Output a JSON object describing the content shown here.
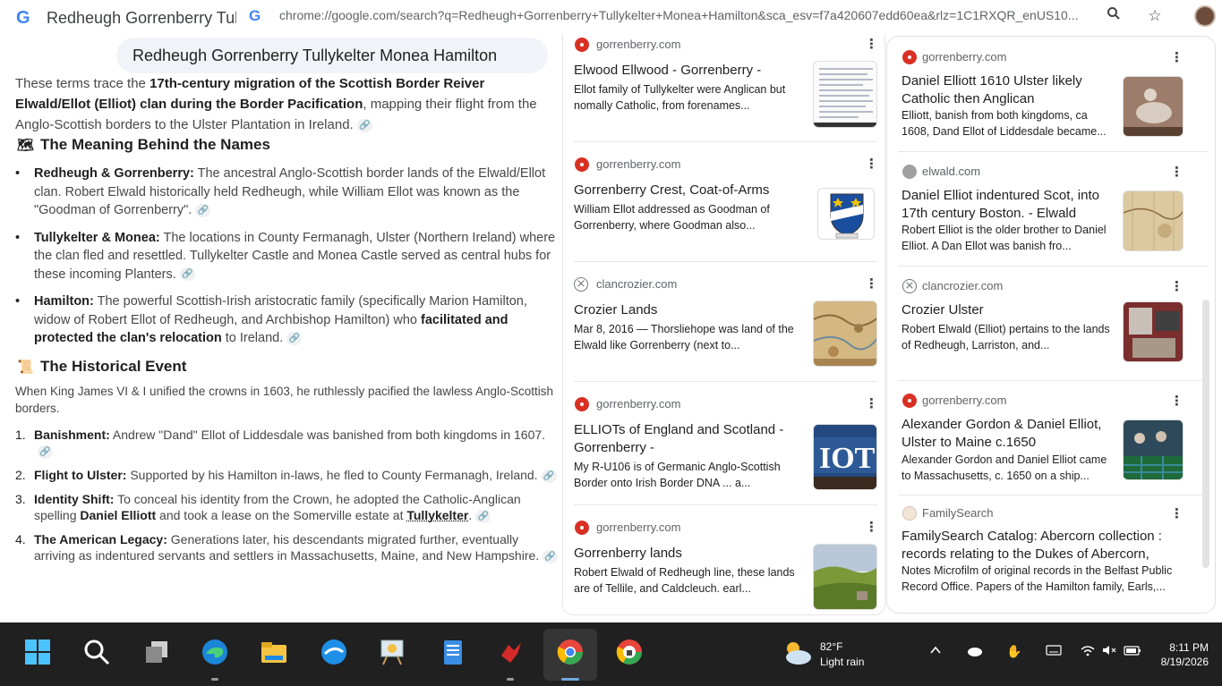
{
  "browser": {
    "tab_title": "Redheugh Gorrenberry Tully",
    "url": "chrome://google.com/search?q=Redheugh+Gorrenberry+Tullykelter+Monea+Hamilton&sca_esv=f7a420607edd60ea&rlz=1C1RXQR_enUS10..."
  },
  "answer": {
    "query": "Redheugh Gorrenberry Tullykelter Monea Hamilton",
    "intro_pre": "These terms trace the ",
    "intro_bold": "17th-century migration of the Scottish Border Reiver Elwald/Ellot (Elliot) clan during the Border Pacification",
    "intro_post": ", mapping their flight from the Anglo-Scottish borders to the Ulster Plantation in Ireland.",
    "section1_title": "The Meaning Behind the Names",
    "section1_emoji": "🗺",
    "names": [
      {
        "term": "Redheugh & Gorrenberry:",
        "text": " The ancestral Anglo-Scottish border lands of the Elwald/Ellot clan. Robert Elwald historically held Redheugh, while William Ellot was known as the \"Goodman of Gorrenberry\"."
      },
      {
        "term": "Tullykelter & Monea:",
        "text": " The locations in County Fermanagh, Ulster (Northern Ireland) where the clan fled and resettled. Tullykelter Castle and Monea Castle served as central hubs for these incoming Planters."
      },
      {
        "term": "Hamilton:",
        "text": " The powerful Scottish-Irish aristocratic family (specifically Marion Hamilton, widow of Robert Ellot of Redheugh, and Archbishop Hamilton) who ",
        "bold2": "facilitated and protected the clan's relocation",
        "tail": " to Ireland."
      }
    ],
    "section2_title": "The Historical Event",
    "section2_emoji": "📜",
    "section2_intro": "When King James VI & I unified the crowns in 1603, he ruthlessly pacified the lawless Anglo-Scottish borders.",
    "events": [
      {
        "n": "1.",
        "term": "Banishment:",
        "text": " Andrew \"Dand\" Ellot of Liddesdale was banished from both kingdoms in 1607."
      },
      {
        "n": "2.",
        "term": "Flight to Ulster:",
        "text": " Supported by his Hamilton in-laws, he fled to County Fermanagh, Ireland."
      },
      {
        "n": "3.",
        "term": "Identity Shift:",
        "text": " To conceal his identity from the Crown, he adopted the Catholic-Anglican spelling ",
        "bold2": "Daniel Elliott",
        "mid": " and took a lease on the Somerville estate at ",
        "bold3": "Tullykelter",
        "tail": "."
      },
      {
        "n": "4.",
        "term": "The American Legacy:",
        "text": " Generations later, his descendants migrated further, eventually arriving as indentured servants and settlers in Massachusetts, Maine, and New Hampshire."
      }
    ]
  },
  "sources_col1": [
    {
      "domain": "gorrenberry.com",
      "favicon": "gorrenberry-favicon",
      "title": "Elwood Ellwood - Gorrenberry -",
      "snippet": "Ellot family of Tullykelter were Anglican but nomally Catholic, from forenames..."
    },
    {
      "domain": "gorrenberry.com",
      "favicon": "gorrenberry-favicon",
      "title": "Gorrenberry Crest, Coat-of-Arms",
      "snippet": "William Ellot addressed as Goodman of Gorrenberry, where Goodman also..."
    },
    {
      "domain": "clancrozier.com",
      "favicon": "clancrozier-favicon",
      "title": "Crozier Lands",
      "snippet": "Mar 8, 2016 — Thorsliehope was land of the Elwald like Gorrenberry (next to..."
    },
    {
      "domain": "gorrenberry.com",
      "favicon": "gorrenberry-favicon",
      "title": "ELLIOTs of England and Scotland - Gorrenberry -",
      "snippet": "My R-U106 is of Germanic Anglo-Scottish Border onto Irish Border DNA ... a..."
    },
    {
      "domain": "gorrenberry.com",
      "favicon": "gorrenberry-favicon",
      "title": "Gorrenberry lands",
      "snippet": "Robert Elwald of Redheugh line, these lands are of Tellile, and Caldcleuch. earl..."
    }
  ],
  "sources_col2": [
    {
      "domain": "gorrenberry.com",
      "favicon": "gorrenberry-favicon",
      "title": "Daniel Elliott 1610 Ulster likely Catholic then Anglican",
      "snippet": "Elliott, banish from both kingdoms, ca 1608, Dand Ellot of Liddesdale became..."
    },
    {
      "domain": "elwald.com",
      "favicon": "elwald-favicon",
      "title": "Daniel Elliot indentured Scot, into 17th century Boston. - Elwald",
      "snippet": "Robert Elliot is the older brother to Daniel Elliot. A Dan Ellot was banish fro..."
    },
    {
      "domain": "clancrozier.com",
      "favicon": "clancrozier-favicon",
      "title": "Crozier Ulster",
      "snippet": "Robert Elwald (Elliot) pertains to the lands of Redheugh, Larriston, and..."
    },
    {
      "domain": "gorrenberry.com",
      "favicon": "gorrenberry-favicon",
      "title": "Alexander Gordon & Daniel Elliot, Ulster to Maine c.1650",
      "snippet": "Alexander Gordon and Daniel Elliot came to Massachusetts, c. 1650 on a ship..."
    },
    {
      "domain": "FamilySearch",
      "favicon": "familysearch-favicon",
      "title": "FamilySearch Catalog: Abercorn collection : records relating to the Dukes of Abercorn, c....",
      "snippet": "Notes Microfilm of original records in the Belfast Public Record Office. Papers of the Hamilton family, Earls,..."
    }
  ],
  "taskbar": {
    "weather_temp": "82°F",
    "weather_cond": "Light rain",
    "time": "8:11 PM",
    "date": "8/19/2026"
  },
  "colors": {
    "google_blue": "#4285f4",
    "taskbar_bg": "#202020",
    "query_bubble": "#f0f4f9",
    "favicon_red": "#d93025"
  }
}
